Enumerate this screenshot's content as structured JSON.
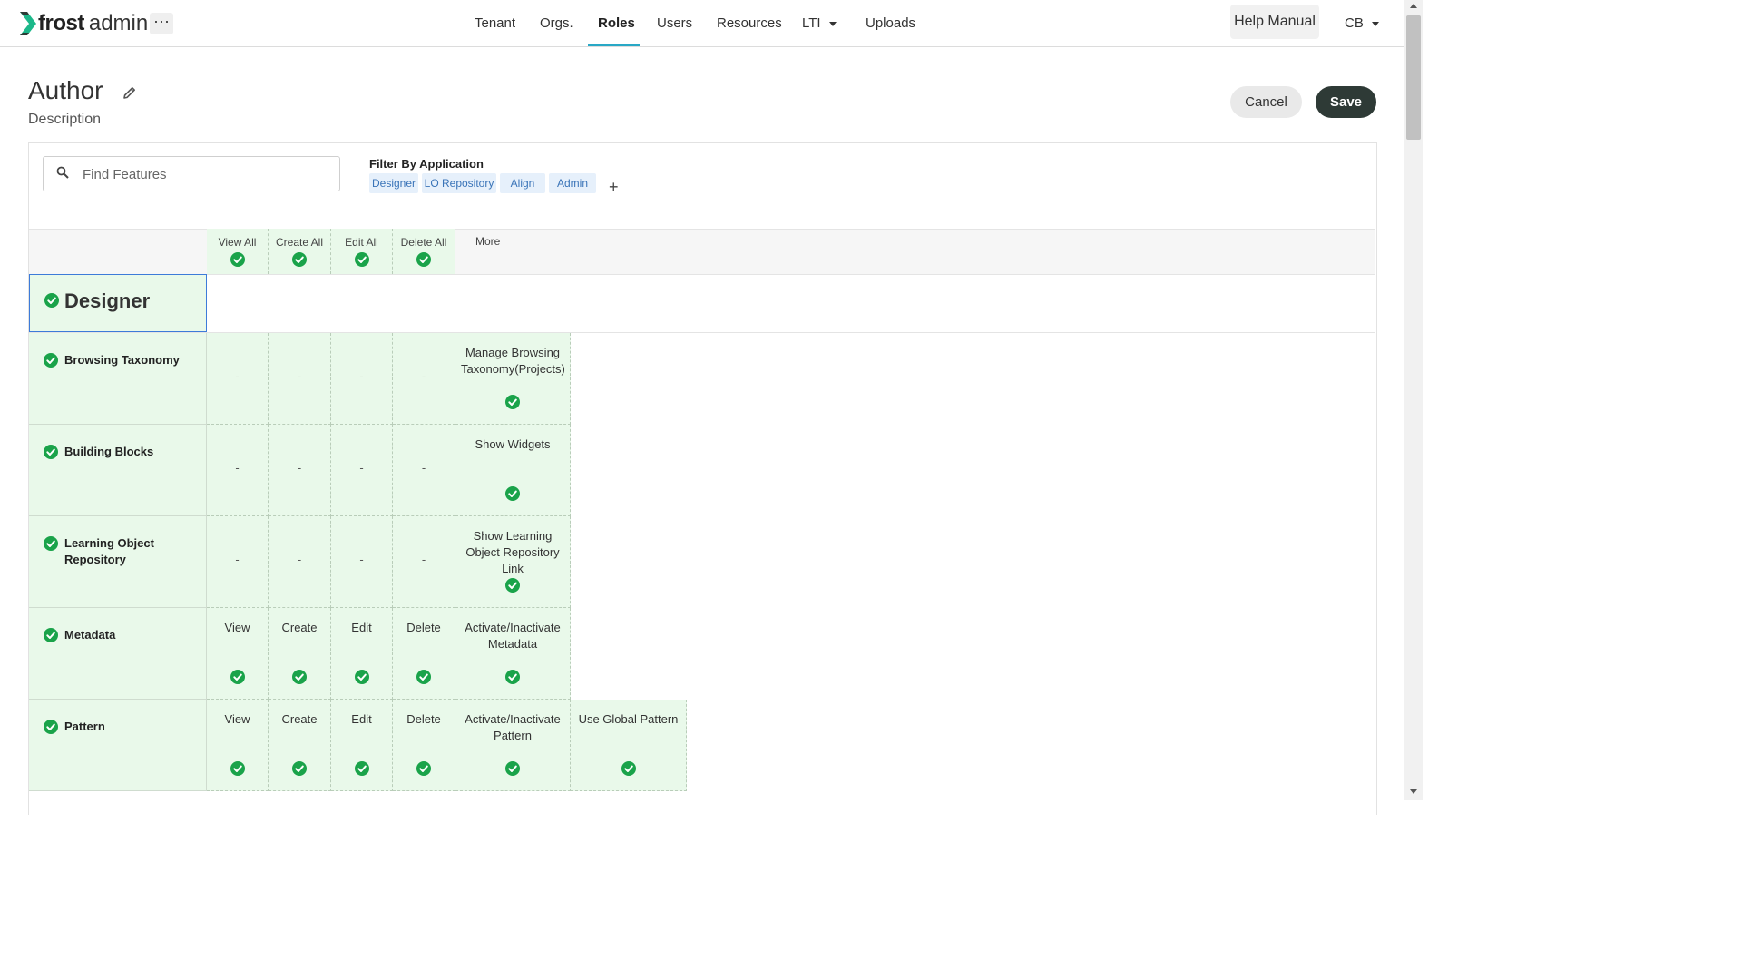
{
  "app": {
    "brand": "frost",
    "suffix": "admin",
    "more_label": "···"
  },
  "nav": {
    "items": [
      "Tenant",
      "Orgs.",
      "Roles",
      "Users",
      "Resources",
      "LTI",
      "Uploads"
    ],
    "active": "Roles"
  },
  "header_right": {
    "help": "Help Manual",
    "user": "CB"
  },
  "page": {
    "title": "Author",
    "description": "Description",
    "cancel": "Cancel",
    "save": "Save"
  },
  "search": {
    "placeholder": "Find Features",
    "value": ""
  },
  "filter": {
    "label": "Filter By Application",
    "chips": [
      "Designer",
      "LO Repository",
      "Align",
      "Admin"
    ],
    "add": "+"
  },
  "columns": {
    "view_all": "View All",
    "create_all": "Create All",
    "edit_all": "Edit All",
    "delete_all": "Delete All",
    "more": "More"
  },
  "section": {
    "name": "Designer"
  },
  "rows": [
    {
      "name": "Browsing Taxonomy",
      "view": "-",
      "create": "-",
      "edit": "-",
      "delete": "-",
      "more": [
        "Manage Browsing Taxonomy(Projects)"
      ]
    },
    {
      "name": "Building Blocks",
      "view": "-",
      "create": "-",
      "edit": "-",
      "delete": "-",
      "more": [
        "Show Widgets"
      ]
    },
    {
      "name": "Learning Object Repository",
      "view": "-",
      "create": "-",
      "edit": "-",
      "delete": "-",
      "more": [
        "Show Learning Object Repository Link"
      ]
    },
    {
      "name": "Metadata",
      "view": "View",
      "create": "Create",
      "edit": "Edit",
      "delete": "Delete",
      "more": [
        "Activate/Inactivate Metadata"
      ]
    },
    {
      "name": "Pattern",
      "view": "View",
      "create": "Create",
      "edit": "Edit",
      "delete": "Delete",
      "more": [
        "Activate/Inactivate Pattern",
        "Use Global Pattern"
      ]
    }
  ],
  "colors": {
    "accent": "#29a8c6",
    "check": "#1aa34a",
    "granted_bg": "#e9f9ea",
    "save_bg": "#2e3a36",
    "chip_text": "#3a74b8"
  },
  "icons": {
    "logo": "frost-chevron-logo",
    "edit": "pencil-icon",
    "search": "search-icon",
    "check": "check-circle-icon",
    "caret": "caret-down-icon"
  }
}
